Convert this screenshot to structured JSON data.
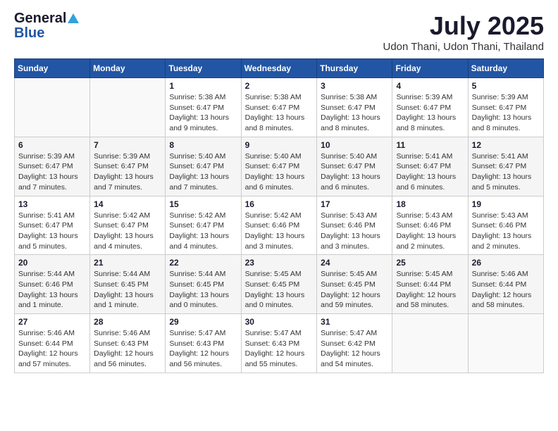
{
  "logo": {
    "general": "General",
    "blue": "Blue"
  },
  "header": {
    "title": "July 2025",
    "subtitle": "Udon Thani, Udon Thani, Thailand"
  },
  "weekdays": [
    "Sunday",
    "Monday",
    "Tuesday",
    "Wednesday",
    "Thursday",
    "Friday",
    "Saturday"
  ],
  "weeks": [
    [
      {
        "day": "",
        "info": ""
      },
      {
        "day": "",
        "info": ""
      },
      {
        "day": "1",
        "info": "Sunrise: 5:38 AM\nSunset: 6:47 PM\nDaylight: 13 hours and 9 minutes."
      },
      {
        "day": "2",
        "info": "Sunrise: 5:38 AM\nSunset: 6:47 PM\nDaylight: 13 hours and 8 minutes."
      },
      {
        "day": "3",
        "info": "Sunrise: 5:38 AM\nSunset: 6:47 PM\nDaylight: 13 hours and 8 minutes."
      },
      {
        "day": "4",
        "info": "Sunrise: 5:39 AM\nSunset: 6:47 PM\nDaylight: 13 hours and 8 minutes."
      },
      {
        "day": "5",
        "info": "Sunrise: 5:39 AM\nSunset: 6:47 PM\nDaylight: 13 hours and 8 minutes."
      }
    ],
    [
      {
        "day": "6",
        "info": "Sunrise: 5:39 AM\nSunset: 6:47 PM\nDaylight: 13 hours and 7 minutes."
      },
      {
        "day": "7",
        "info": "Sunrise: 5:39 AM\nSunset: 6:47 PM\nDaylight: 13 hours and 7 minutes."
      },
      {
        "day": "8",
        "info": "Sunrise: 5:40 AM\nSunset: 6:47 PM\nDaylight: 13 hours and 7 minutes."
      },
      {
        "day": "9",
        "info": "Sunrise: 5:40 AM\nSunset: 6:47 PM\nDaylight: 13 hours and 6 minutes."
      },
      {
        "day": "10",
        "info": "Sunrise: 5:40 AM\nSunset: 6:47 PM\nDaylight: 13 hours and 6 minutes."
      },
      {
        "day": "11",
        "info": "Sunrise: 5:41 AM\nSunset: 6:47 PM\nDaylight: 13 hours and 6 minutes."
      },
      {
        "day": "12",
        "info": "Sunrise: 5:41 AM\nSunset: 6:47 PM\nDaylight: 13 hours and 5 minutes."
      }
    ],
    [
      {
        "day": "13",
        "info": "Sunrise: 5:41 AM\nSunset: 6:47 PM\nDaylight: 13 hours and 5 minutes."
      },
      {
        "day": "14",
        "info": "Sunrise: 5:42 AM\nSunset: 6:47 PM\nDaylight: 13 hours and 4 minutes."
      },
      {
        "day": "15",
        "info": "Sunrise: 5:42 AM\nSunset: 6:47 PM\nDaylight: 13 hours and 4 minutes."
      },
      {
        "day": "16",
        "info": "Sunrise: 5:42 AM\nSunset: 6:46 PM\nDaylight: 13 hours and 3 minutes."
      },
      {
        "day": "17",
        "info": "Sunrise: 5:43 AM\nSunset: 6:46 PM\nDaylight: 13 hours and 3 minutes."
      },
      {
        "day": "18",
        "info": "Sunrise: 5:43 AM\nSunset: 6:46 PM\nDaylight: 13 hours and 2 minutes."
      },
      {
        "day": "19",
        "info": "Sunrise: 5:43 AM\nSunset: 6:46 PM\nDaylight: 13 hours and 2 minutes."
      }
    ],
    [
      {
        "day": "20",
        "info": "Sunrise: 5:44 AM\nSunset: 6:46 PM\nDaylight: 13 hours and 1 minute."
      },
      {
        "day": "21",
        "info": "Sunrise: 5:44 AM\nSunset: 6:45 PM\nDaylight: 13 hours and 1 minute."
      },
      {
        "day": "22",
        "info": "Sunrise: 5:44 AM\nSunset: 6:45 PM\nDaylight: 13 hours and 0 minutes."
      },
      {
        "day": "23",
        "info": "Sunrise: 5:45 AM\nSunset: 6:45 PM\nDaylight: 13 hours and 0 minutes."
      },
      {
        "day": "24",
        "info": "Sunrise: 5:45 AM\nSunset: 6:45 PM\nDaylight: 12 hours and 59 minutes."
      },
      {
        "day": "25",
        "info": "Sunrise: 5:45 AM\nSunset: 6:44 PM\nDaylight: 12 hours and 58 minutes."
      },
      {
        "day": "26",
        "info": "Sunrise: 5:46 AM\nSunset: 6:44 PM\nDaylight: 12 hours and 58 minutes."
      }
    ],
    [
      {
        "day": "27",
        "info": "Sunrise: 5:46 AM\nSunset: 6:44 PM\nDaylight: 12 hours and 57 minutes."
      },
      {
        "day": "28",
        "info": "Sunrise: 5:46 AM\nSunset: 6:43 PM\nDaylight: 12 hours and 56 minutes."
      },
      {
        "day": "29",
        "info": "Sunrise: 5:47 AM\nSunset: 6:43 PM\nDaylight: 12 hours and 56 minutes."
      },
      {
        "day": "30",
        "info": "Sunrise: 5:47 AM\nSunset: 6:43 PM\nDaylight: 12 hours and 55 minutes."
      },
      {
        "day": "31",
        "info": "Sunrise: 5:47 AM\nSunset: 6:42 PM\nDaylight: 12 hours and 54 minutes."
      },
      {
        "day": "",
        "info": ""
      },
      {
        "day": "",
        "info": ""
      }
    ]
  ]
}
